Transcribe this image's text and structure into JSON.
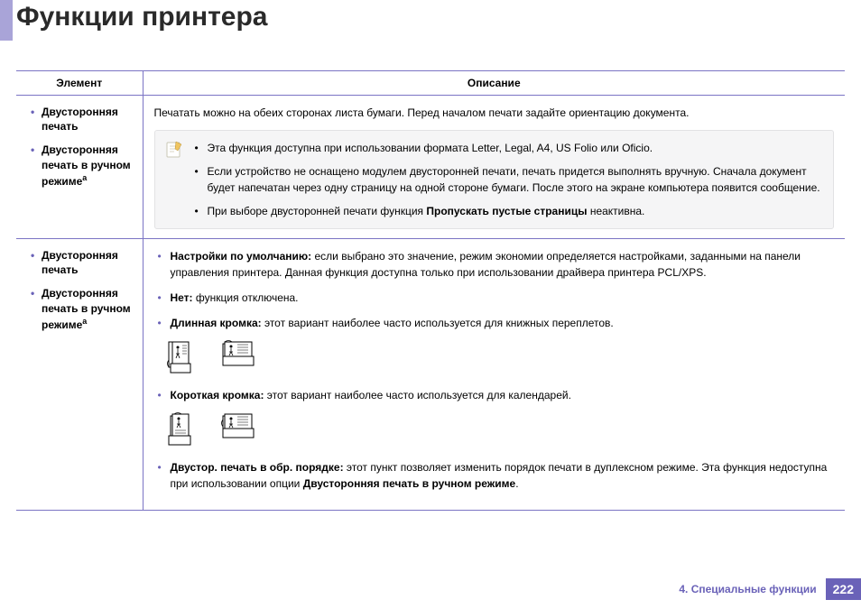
{
  "title": "Функции принтера",
  "table": {
    "headers": {
      "element": "Элемент",
      "description": "Описание"
    },
    "rows": [
      {
        "items": [
          "Двусторонняя печать",
          "Двусторонняя печать в ручном режиме"
        ],
        "sup": "a",
        "intro": "Печатать можно на обеих сторонах листа бумаги. Перед началом печати задайте ориентацию документа.",
        "notes": [
          "Эта функция доступна при использовании формата Letter, Legal, A4, US Folio или Oficio.",
          "Если устройство не оснащено модулем двусторонней печати, печать придется выполнять вручную. Сначала документ будет напечатан через одну страницу на одной стороне бумаги. После этого на экране компьютера появится сообщение.",
          {
            "pre": "При выборе двусторонней печати функция ",
            "bold": "Пропускать пустые страницы",
            "post": " неактивна."
          }
        ]
      },
      {
        "items": [
          "Двусторонняя печать",
          "Двусторонняя печать в ручном режиме"
        ],
        "sup": "a",
        "bullets": [
          {
            "bold": "Настройки по умолчанию:",
            "text": " если выбрано это значение, режим экономии определяется настройками, заданными на панели управления принтера. Данная функция доступна только при использовании драйвера принтера PCL/XPS."
          },
          {
            "bold": "Нет:",
            "text": " функция отключена."
          },
          {
            "bold": "Длинная кромка:",
            "text": " этот вариант наиболее часто используется для книжных переплетов."
          },
          {
            "illus": "long"
          },
          {
            "bold": "Короткая кромка:",
            "text": " этот вариант наиболее часто используется для календарей."
          },
          {
            "illus": "short"
          },
          {
            "bold": "Двустор. печать в обр. порядке:",
            "text": " этот пункт позволяет изменить порядок печати в дуплексном режиме. Эта функция недоступна при использовании опции ",
            "bold2": "Двусторонняя печать в ручном режиме",
            "post": "."
          }
        ]
      }
    ]
  },
  "footer": {
    "section": "4.  Специальные функции",
    "page": "222"
  }
}
